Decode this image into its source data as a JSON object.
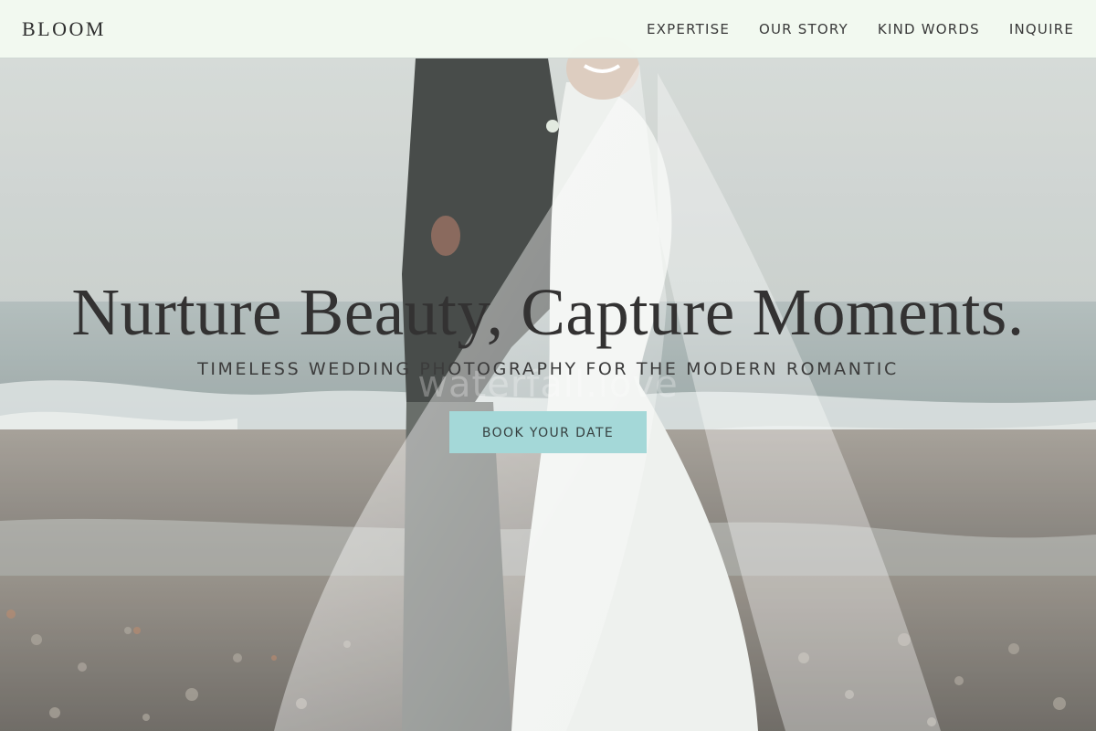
{
  "brand": {
    "name": "BLOOM"
  },
  "nav": {
    "items": [
      {
        "label": "EXPERTISE"
      },
      {
        "label": "OUR STORY"
      },
      {
        "label": "KIND WORDS"
      },
      {
        "label": "INQUIRE"
      }
    ]
  },
  "hero": {
    "headline": "Nurture Beauty, Capture Moments.",
    "tagline": "TIMELESS WEDDING PHOTOGRAPHY FOR THE MODERN ROMANTIC",
    "cta_label": "BOOK YOUR DATE",
    "watermark": "waterfall.love"
  },
  "colors": {
    "header_bg": "#f3faf0",
    "cta_bg": "#a4d8d8",
    "text_dark": "#333232"
  }
}
